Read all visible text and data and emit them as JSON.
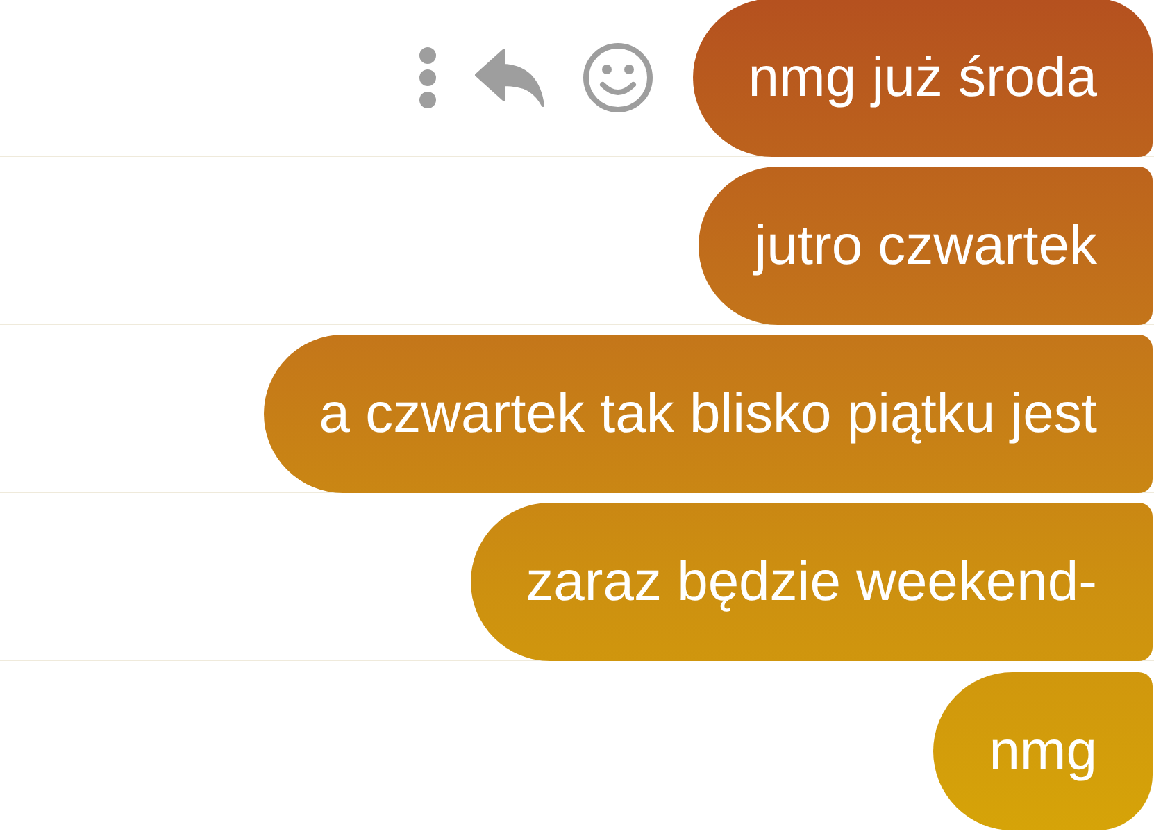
{
  "messages": [
    {
      "text": "nmg już środa"
    },
    {
      "text": "jutro czwartek"
    },
    {
      "text": "a czwartek tak blisko piątku jest"
    },
    {
      "text": "zaraz będzie weekend-"
    },
    {
      "text": "nmg"
    }
  ]
}
